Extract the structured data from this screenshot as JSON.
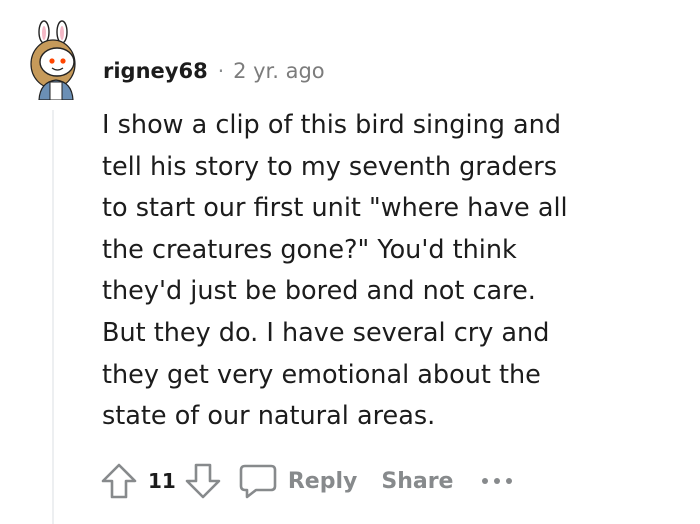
{
  "comment": {
    "username": "rigney68",
    "separator": "·",
    "timestamp": "2 yr. ago",
    "body_lines": [
      "I show a clip of this bird singing and",
      "tell his story to my seventh graders",
      "to start our first unit \"where have all",
      "the creatures gone?\" You'd think",
      "they'd just be bored and not care.",
      "But they do. I have several cry and",
      "they get very emotional about the",
      "state of our natural areas."
    ],
    "score": "11",
    "actions": {
      "reply_label": "Reply",
      "share_label": "Share",
      "more_icon": "ellipsis-icon"
    },
    "icons": {
      "avatar": "snoo-bunny-avatar",
      "upvote": "upvote-arrow-icon",
      "downvote": "downvote-arrow-icon",
      "reply": "speech-bubble-icon"
    }
  },
  "colors": {
    "text": "#1c1c1c",
    "muted": "#878a8c",
    "thread_line": "#edeff1"
  }
}
